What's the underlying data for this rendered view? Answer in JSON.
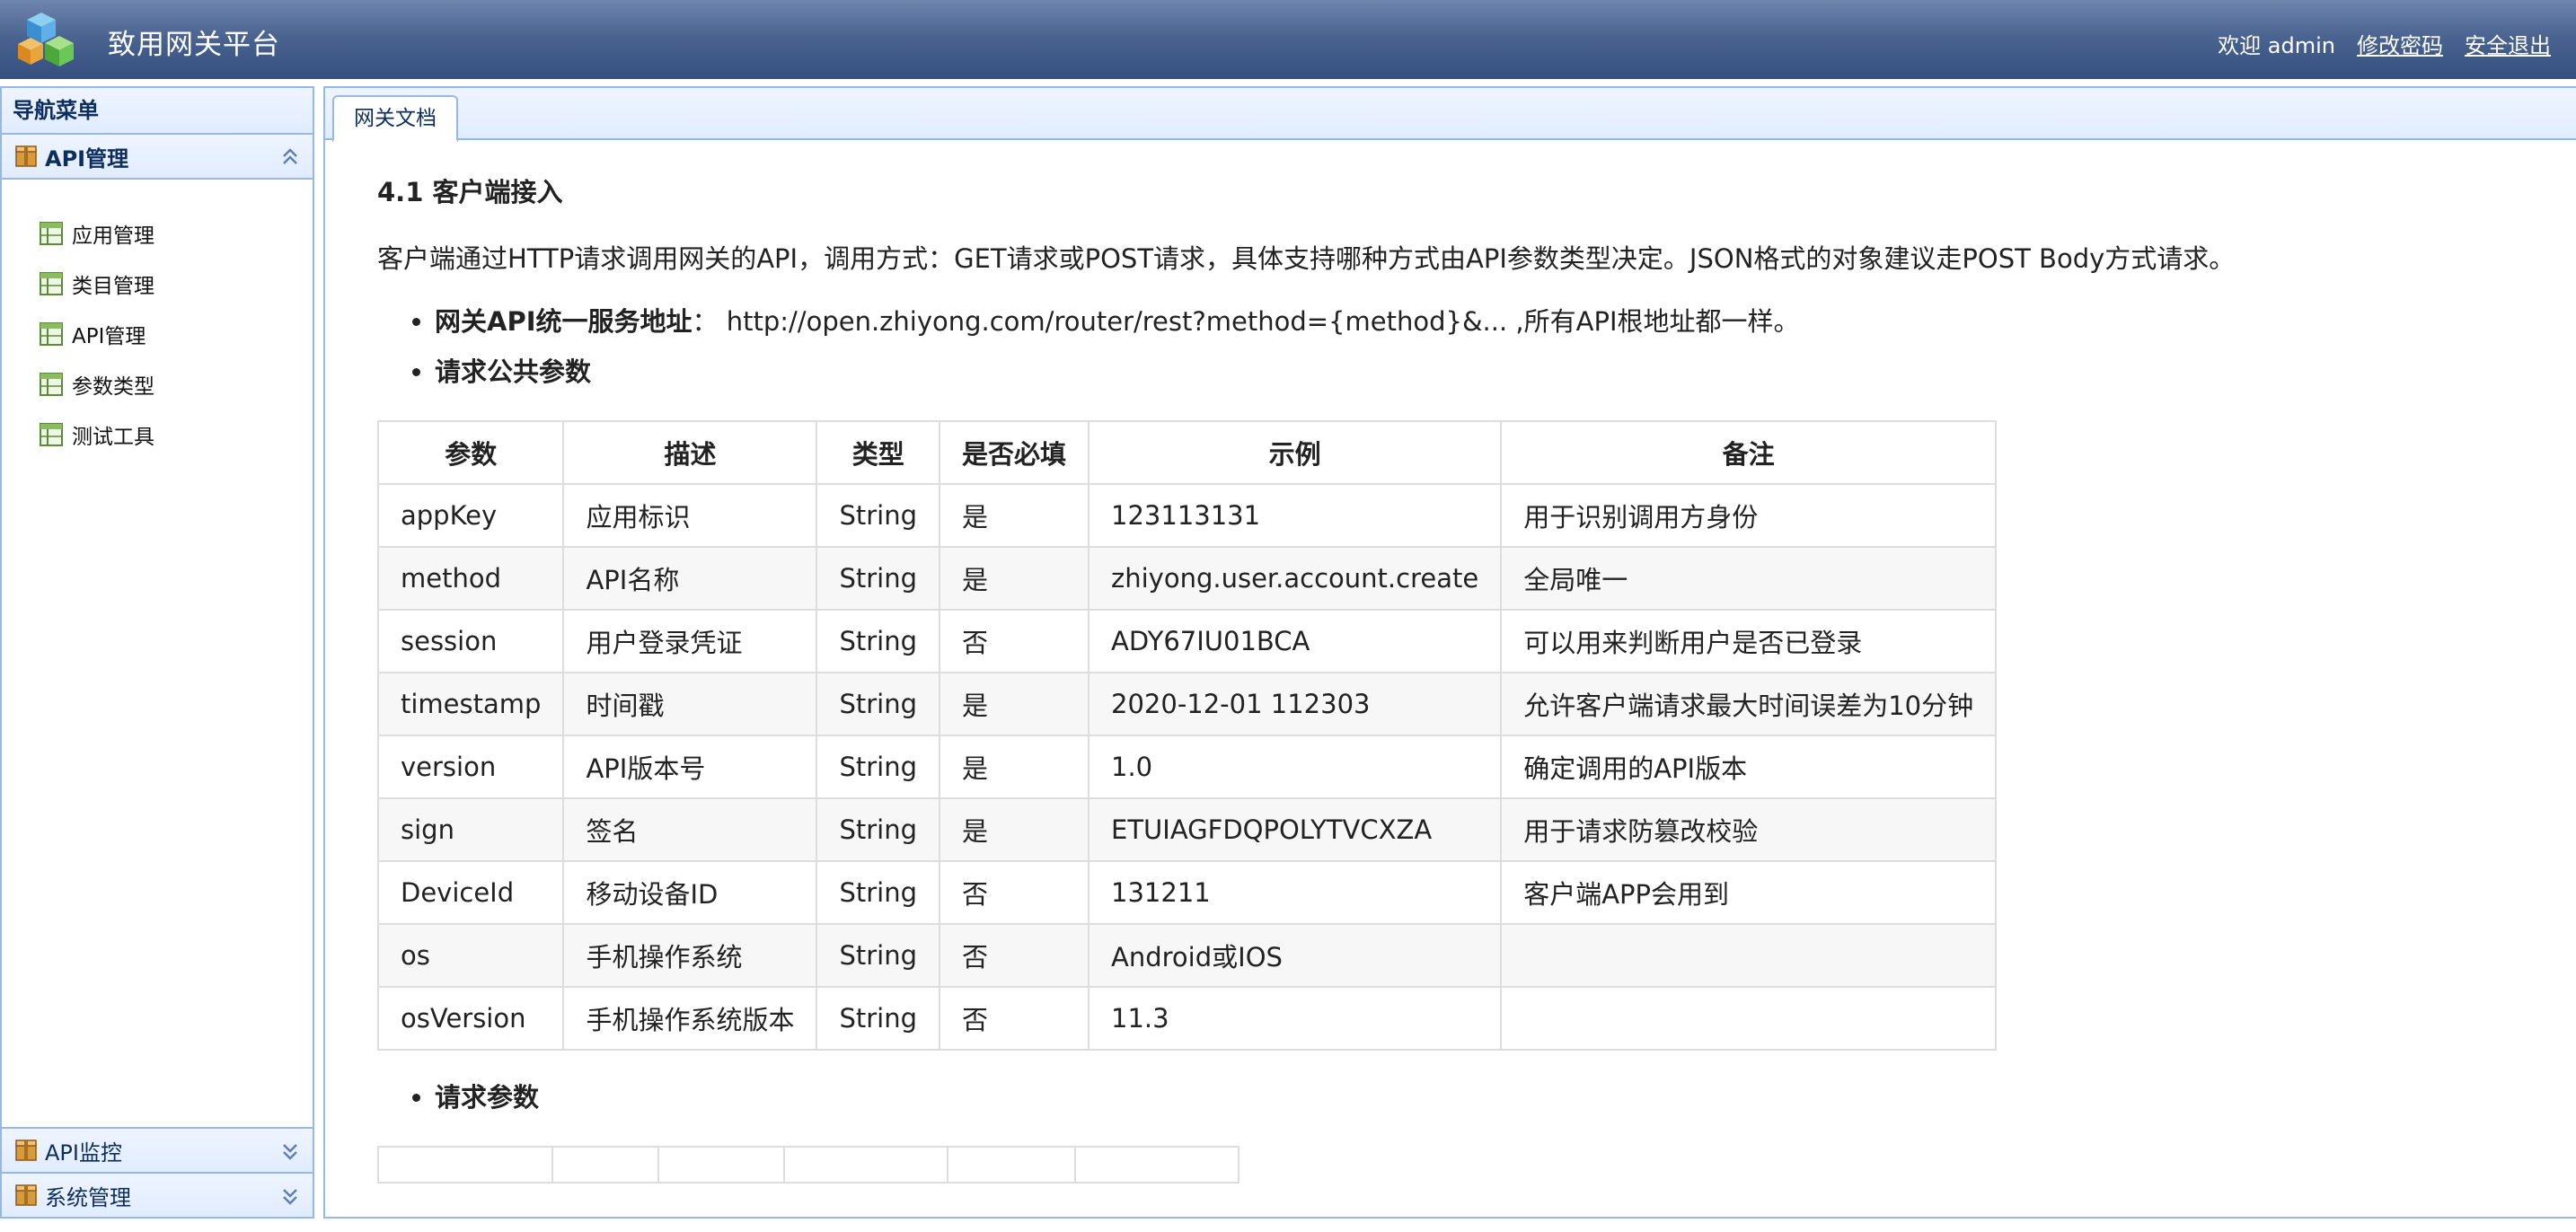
{
  "header": {
    "title": "致用网关平台",
    "welcome": "欢迎 admin",
    "change_password": "修改密码",
    "logout": "安全退出"
  },
  "sidebar": {
    "title": "导航菜单",
    "sections": [
      {
        "label": "API管理",
        "expanded": true,
        "items": [
          "应用管理",
          "类目管理",
          "API管理",
          "参数类型",
          "测试工具"
        ]
      },
      {
        "label": "API监控",
        "expanded": false
      },
      {
        "label": "系统管理",
        "expanded": false
      }
    ]
  },
  "tabs": [
    {
      "label": "网关文档",
      "active": true
    }
  ],
  "doc": {
    "section_title": "4.1 客户端接入",
    "intro": "客户端通过HTTP请求调用网关的API，调用方式：GET请求或POST请求，具体支持哪种方式由API参数类型决定。JSON格式的对象建议走POST Body方式请求。",
    "bullets": {
      "gateway_label": "网关API统一服务地址",
      "gateway_sep": "：",
      "gateway_value": "http://open.zhiyong.com/router/rest?method={method}&... ,所有API根地址都一样。",
      "common_params": "请求公共参数",
      "request_params": "请求参数"
    },
    "table": {
      "headers": [
        "参数",
        "描述",
        "类型",
        "是否必填",
        "示例",
        "备注"
      ],
      "rows": [
        [
          "appKey",
          "应用标识",
          "String",
          "是",
          "123113131",
          "用于识别调用方身份"
        ],
        [
          "method",
          "API名称",
          "String",
          "是",
          "zhiyong.user.account.create",
          "全局唯一"
        ],
        [
          "session",
          "用户登录凭证",
          "String",
          "否",
          "ADY67IU01BCA",
          "可以用来判断用户是否已登录"
        ],
        [
          "timestamp",
          "时间戳",
          "String",
          "是",
          "2020-12-01 112303",
          "允许客户端请求最大时间误差为10分钟"
        ],
        [
          "version",
          "API版本号",
          "String",
          "是",
          "1.0",
          "确定调用的API版本"
        ],
        [
          "sign",
          "签名",
          "String",
          "是",
          "ETUIAGFDQPOLYTVCXZA",
          "用于请求防篡改校验"
        ],
        [
          "DeviceId",
          "移动设备ID",
          "String",
          "否",
          "131211",
          "客户端APP会用到"
        ],
        [
          "os",
          "手机操作系统",
          "String",
          "否",
          "Android或IOS",
          ""
        ],
        [
          "osVersion",
          "手机操作系统版本",
          "String",
          "否",
          "11.3",
          ""
        ]
      ]
    }
  },
  "icons": {
    "logo": "cubes-logo-icon",
    "section": "package-box-icon",
    "item": "table-tree-icon",
    "collapse": "double-chevron-up-icon",
    "expand": "double-chevron-down-icon"
  },
  "colors": {
    "header_top": "#6f86ad",
    "header_bottom": "#34507f",
    "panel_border": "#95b8e7",
    "panel_bg": "#e0ecff",
    "panel_text": "#0e2d5f"
  }
}
